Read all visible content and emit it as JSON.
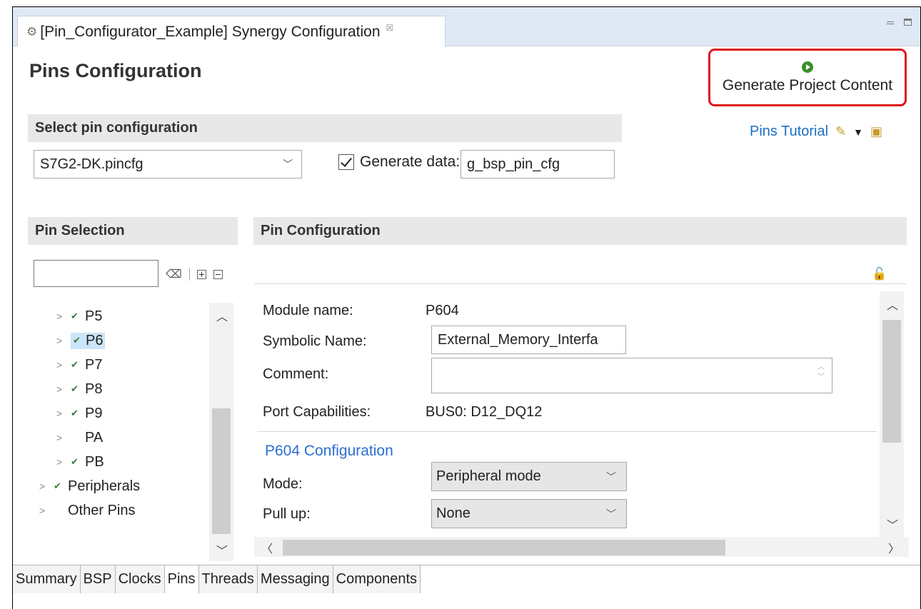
{
  "editor_tab": {
    "title": "[Pin_Configurator_Example] Synergy Configuration",
    "close_glyph": "☒"
  },
  "page": {
    "title": "Pins Configuration"
  },
  "generate_button": {
    "label": "Generate Project Content",
    "accent": "#e0141b"
  },
  "select_pin_config": {
    "header": "Select pin configuration",
    "selected_file": "S7G2-DK.pincfg",
    "generate_data_label": "Generate data:",
    "generate_data_checked": true,
    "generate_data_value": "g_bsp_pin_cfg"
  },
  "tutorial_link": {
    "label": "Pins Tutorial"
  },
  "pin_selection": {
    "header": "Pin Selection",
    "filter_value": "",
    "tree": [
      {
        "label": "P5",
        "checked": true,
        "selected": false
      },
      {
        "label": "P6",
        "checked": true,
        "selected": true
      },
      {
        "label": "P7",
        "checked": true,
        "selected": false
      },
      {
        "label": "P8",
        "checked": true,
        "selected": false
      },
      {
        "label": "P9",
        "checked": true,
        "selected": false
      },
      {
        "label": "PA",
        "checked": false,
        "selected": false
      },
      {
        "label": "PB",
        "checked": true,
        "selected": false
      },
      {
        "label": "Peripherals",
        "checked": true,
        "selected": false
      },
      {
        "label": "Other Pins",
        "checked": false,
        "selected": false
      }
    ]
  },
  "pin_configuration": {
    "header": "Pin Configuration",
    "module_name_label": "Module name:",
    "module_name_value": "P604",
    "symbolic_name_label": "Symbolic Name:",
    "symbolic_name_value": "External_Memory_Interfa",
    "comment_label": "Comment:",
    "comment_value": "",
    "port_capabilities_label": "Port Capabilities:",
    "port_capabilities_value": "BUS0: D12_DQ12",
    "section_title": "P604 Configuration",
    "mode_label": "Mode:",
    "mode_value": "Peripheral mode",
    "pull_up_label": "Pull up:",
    "pull_up_value": "None"
  },
  "bottom_tabs": [
    "Summary",
    "BSP",
    "Clocks",
    "Pins",
    "Threads",
    "Messaging",
    "Components"
  ],
  "active_bottom_tab": "Pins"
}
